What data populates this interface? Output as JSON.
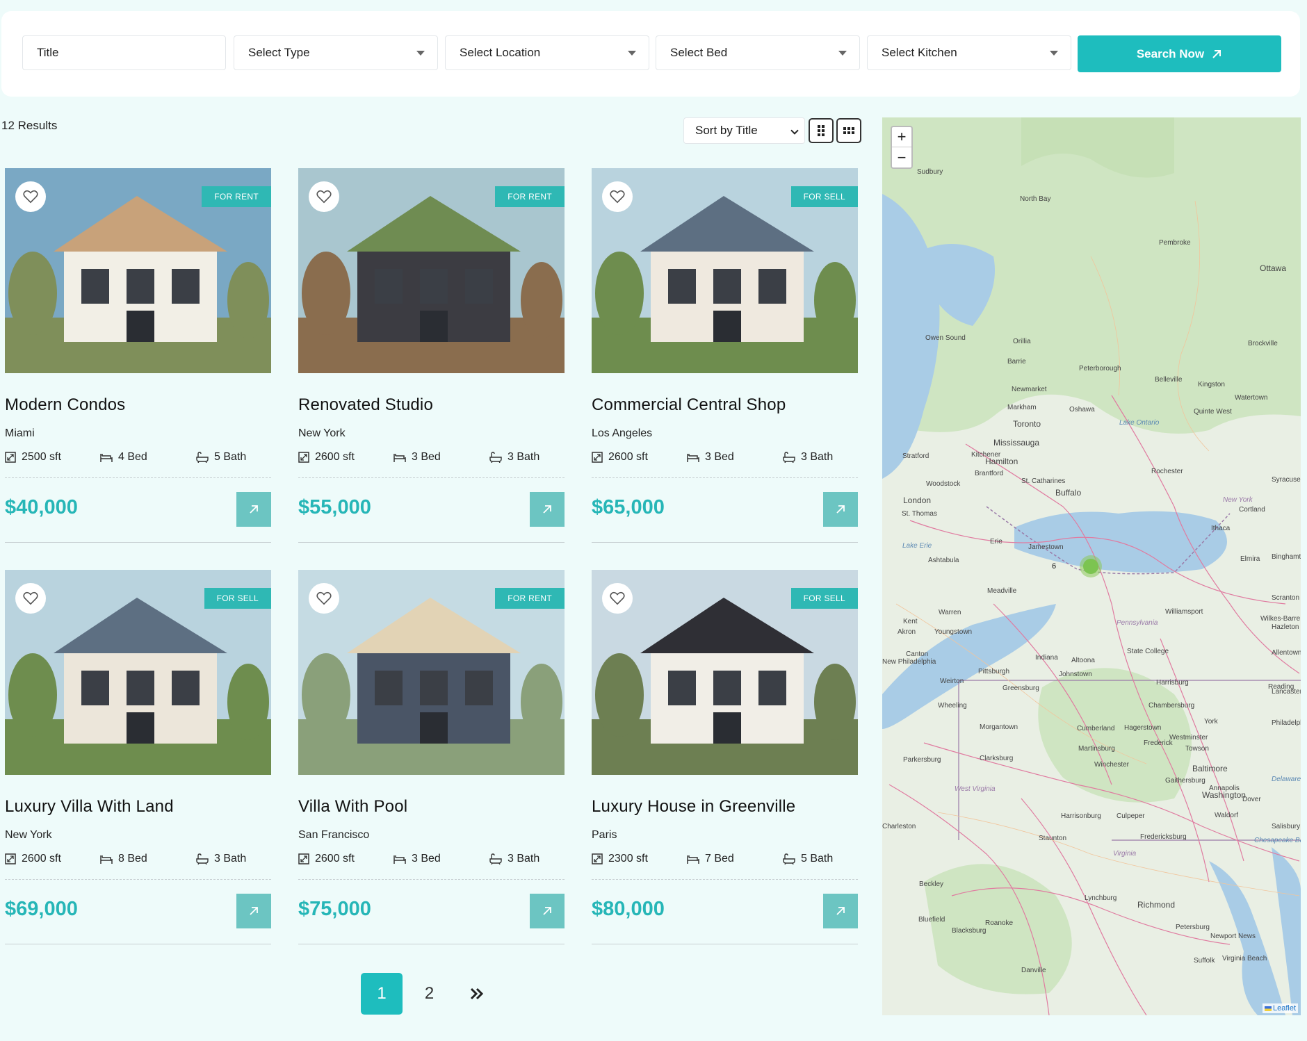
{
  "search": {
    "title_placeholder": "Title",
    "type_label": "Select Type",
    "location_label": "Select Location",
    "bed_label": "Select Bed",
    "kitchen_label": "Select Kitchen",
    "button_label": "Search Now"
  },
  "toolbar": {
    "results": "12 Results",
    "sort_label": "Sort by Title"
  },
  "listings": [
    {
      "title": "Modern Condos",
      "city": "Miami",
      "area": "2500 sft",
      "beds": "4 Bed",
      "baths": "5 Bath",
      "price": "$40,000",
      "badge": "FOR RENT"
    },
    {
      "title": "Renovated Studio",
      "city": "New York",
      "area": "2600 sft",
      "beds": "3 Bed",
      "baths": "3 Bath",
      "price": "$55,000",
      "badge": "FOR RENT"
    },
    {
      "title": "Commercial Central Shop",
      "city": "Los Angeles",
      "area": "2600 sft",
      "beds": "3 Bed",
      "baths": "3 Bath",
      "price": "$65,000",
      "badge": "FOR SELL"
    },
    {
      "title": "Luxury Villa With Land",
      "city": "New York",
      "area": "2600 sft",
      "beds": "8 Bed",
      "baths": "3 Bath",
      "price": "$69,000",
      "badge": "FOR SELL"
    },
    {
      "title": "Villa With Pool",
      "city": "San Francisco",
      "area": "2600 sft",
      "beds": "3 Bed",
      "baths": "3 Bath",
      "price": "$75,000",
      "badge": "FOR RENT"
    },
    {
      "title": "Luxury House in Greenville",
      "city": "Paris",
      "area": "2300 sft",
      "beds": "7 Bed",
      "baths": "5 Bath",
      "price": "$80,000",
      "badge": "FOR SELL"
    }
  ],
  "pagination": {
    "page1": "1",
    "page2": "2",
    "next": "»"
  },
  "map": {
    "zoom_in": "+",
    "zoom_out": "−",
    "cluster_count": "6",
    "attribution": "Leaflet",
    "labels": [
      "Sudbury",
      "North Bay",
      "Pembroke",
      "Ottawa",
      "Owen Sound",
      "Orillia",
      "Barrie",
      "Peterborough",
      "Brockville",
      "Kingston",
      "Watertown",
      "Belleville",
      "Quinte West",
      "Newmarket",
      "Markham",
      "Oshawa",
      "Toronto",
      "Lake Ontario",
      "Mississauga",
      "Stratford",
      "Kitchener",
      "Hamilton",
      "Brantford",
      "Woodstock",
      "Rochester",
      "Syracuse",
      "St. Catharines",
      "Buffalo",
      "London",
      "St. Thomas",
      "New York",
      "Cortland",
      "Ithaca",
      "Lake Erie",
      "Erie",
      "Jamestown",
      "Elmira",
      "Binghamton",
      "Ashtabula",
      "Meadville",
      "Scranton",
      "Warren",
      "Williamsport",
      "Kent",
      "Akron",
      "Youngstown",
      "Pennsylvania",
      "Wilkes-Barre",
      "Hazleton",
      "Canton",
      "Indiana",
      "State College",
      "Allentown",
      "New Philadelphia",
      "Pittsburgh",
      "Altoona",
      "Johnstown",
      "Weirton",
      "Greensburg",
      "Harrisburg",
      "Reading",
      "Lancaster",
      "Wheeling",
      "Chambersburg",
      "York",
      "Morgantown",
      "Cumberland",
      "Hagerstown",
      "Westminster",
      "Philadelphia",
      "Martinsburg",
      "Frederick",
      "Towson",
      "Parkersburg",
      "Clarksburg",
      "Winchester",
      "Baltimore",
      "Delaware",
      "Gaithersburg",
      "Annapolis",
      "West Virginia",
      "Washington",
      "Dover",
      "Harrisonburg",
      "Culpeper",
      "Waldorf",
      "Charleston",
      "Salisbury",
      "Staunton",
      "Fredericksburg",
      "Chesapeake Bay",
      "Virginia",
      "Beckley",
      "Lynchburg",
      "Richmond",
      "Bluefield",
      "Roanoke",
      "Blacksburg",
      "Petersburg",
      "Newport News",
      "Suffolk",
      "Virginia Beach",
      "Danville"
    ]
  },
  "colors": {
    "accent": "#1ebdbe",
    "price": "#26b6b7",
    "badge": "#2fb8b4",
    "go_button": "#6cc5c2",
    "background": "#eefbfa"
  }
}
